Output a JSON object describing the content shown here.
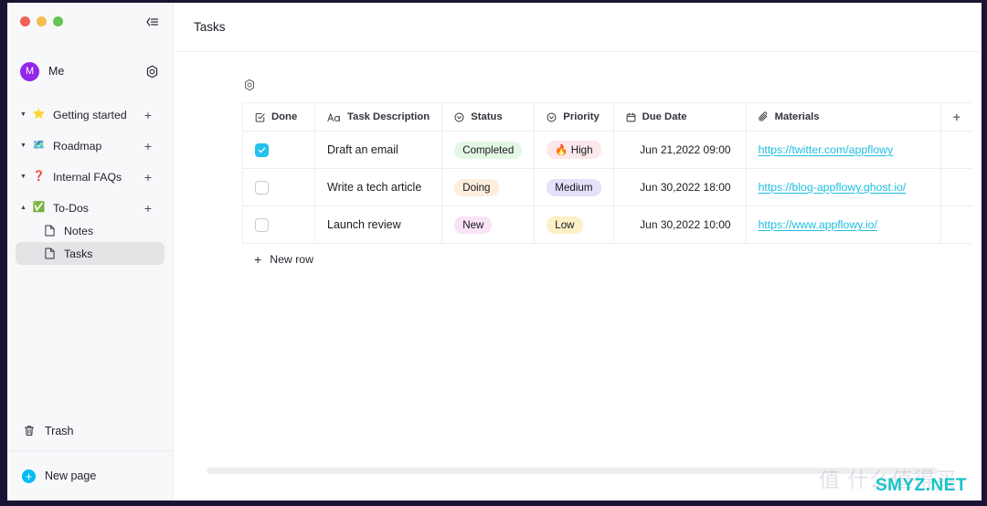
{
  "window": {
    "traffic_lights": [
      "close-red",
      "minimize-yellow",
      "maximize-green"
    ],
    "collapse_icon": "collapse-sidebar-icon"
  },
  "sidebar": {
    "user": {
      "avatar_initial": "M",
      "name": "Me",
      "avatar_color": "#9327ea",
      "settings_icon": "gear-icon"
    },
    "items": [
      {
        "label": "Getting started",
        "emoji": "⭐",
        "icon": "star-emoji",
        "expanded": true,
        "add_label": "+"
      },
      {
        "label": "Roadmap",
        "emoji": "🗺️",
        "icon": "map-emoji",
        "expanded": true,
        "add_label": "+"
      },
      {
        "label": "Internal FAQs",
        "emoji": "❓",
        "icon": "question-emoji",
        "expanded": true,
        "add_label": "+"
      },
      {
        "label": "To-Dos",
        "emoji": "✅",
        "icon": "check-emoji",
        "expanded": true,
        "add_label": "+"
      }
    ],
    "children": [
      {
        "label": "Notes",
        "icon": "document-icon",
        "selected": false
      },
      {
        "label": "Tasks",
        "icon": "document-icon",
        "selected": true
      }
    ],
    "trash": {
      "label": "Trash",
      "icon": "trash-icon"
    },
    "new_page": {
      "label": "New page",
      "icon": "plus-circle-icon",
      "color": "#00bcf0"
    }
  },
  "header": {
    "title": "Tasks"
  },
  "grid_toolbar": {
    "settings_icon": "grid-settings-icon"
  },
  "table": {
    "add_column_label": "+",
    "columns": [
      {
        "label": "Done",
        "icon": "checkbox-field-icon"
      },
      {
        "label": "Task Description",
        "icon": "text-field-icon"
      },
      {
        "label": "Status",
        "icon": "single-select-field-icon"
      },
      {
        "label": "Priority",
        "icon": "single-select-field-icon"
      },
      {
        "label": "Due Date",
        "icon": "calendar-field-icon"
      },
      {
        "label": "Materials",
        "icon": "paperclip-field-icon"
      }
    ],
    "rows": [
      {
        "done": true,
        "description": "Draft an email",
        "status": {
          "label": "Completed",
          "bg": "#e2f8e4",
          "fg": "#16161d"
        },
        "priority": {
          "label": "High",
          "emoji": "🔥",
          "bg": "#fce8ea",
          "fg": "#16161d"
        },
        "due_date": "Jun 21,2022  09:00",
        "material": "https://twitter.com/appflowy"
      },
      {
        "done": false,
        "description": "Write a tech article",
        "status": {
          "label": "Doing",
          "bg": "#fdeedd",
          "fg": "#16161d"
        },
        "priority": {
          "label": "Medium",
          "emoji": "",
          "bg": "#e4e1fa",
          "fg": "#16161d"
        },
        "due_date": "Jun 30,2022  18:00",
        "material": "https://blog-appflowy.ghost.io/"
      },
      {
        "done": false,
        "description": "Launch review",
        "status": {
          "label": "New",
          "bg": "#fae3f6",
          "fg": "#16161d"
        },
        "priority": {
          "label": "Low",
          "emoji": "",
          "bg": "#fcf0c7",
          "fg": "#16161d"
        },
        "due_date": "Jun 30,2022  10:00",
        "material": "https://www.appflowy.io/"
      }
    ],
    "new_row_label": "New row",
    "new_row_icon": "plus-icon"
  },
  "watermark": {
    "cn_text": "值 什么值得买",
    "site_text": "SMYZ.NET",
    "site_color": "#16c3c9"
  },
  "colors": {
    "link": "#1ebfe0",
    "checkbox_checked": "#24c0ee",
    "accent": "#00bcf0",
    "sidebar_bg": "#f7f8fa"
  }
}
